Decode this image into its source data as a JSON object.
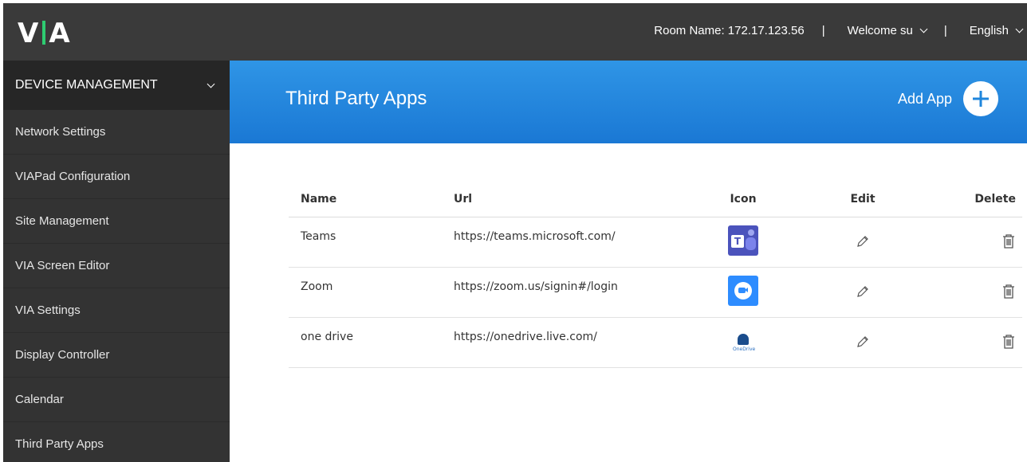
{
  "header": {
    "logo": "VIA",
    "room_name": "Room Name: 172.17.123.56",
    "separator": "|",
    "welcome": "Welcome su",
    "language": "English"
  },
  "sidebar": {
    "section_label": "DEVICE MANAGEMENT",
    "items": [
      {
        "label": "Network Settings"
      },
      {
        "label": "VIAPad Configuration"
      },
      {
        "label": "Site Management"
      },
      {
        "label": "VIA Screen Editor"
      },
      {
        "label": "VIA Settings"
      },
      {
        "label": "Display Controller"
      },
      {
        "label": "Calendar"
      },
      {
        "label": "Third Party Apps"
      }
    ]
  },
  "main": {
    "title": "Third Party Apps",
    "add_app_label": "Add App",
    "table": {
      "columns": [
        "Name",
        "Url",
        "Icon",
        "Edit",
        "Delete"
      ],
      "rows": [
        {
          "name": "Teams",
          "url": "https://teams.microsoft.com/",
          "icon": "teams-icon"
        },
        {
          "name": "Zoom",
          "url": "https://zoom.us/signin#/login",
          "icon": "zoom-icon"
        },
        {
          "name": "one drive",
          "url": "https://onedrive.live.com/",
          "icon": "onedrive-icon",
          "icon_caption": "OneDrive"
        }
      ]
    }
  },
  "colors": {
    "topbar": "#3a3a3a",
    "sidebar": "#333333",
    "sidebar_header": "#262626",
    "banner_accent": "#1f86dc",
    "logo_bar": "#2ecc71"
  }
}
